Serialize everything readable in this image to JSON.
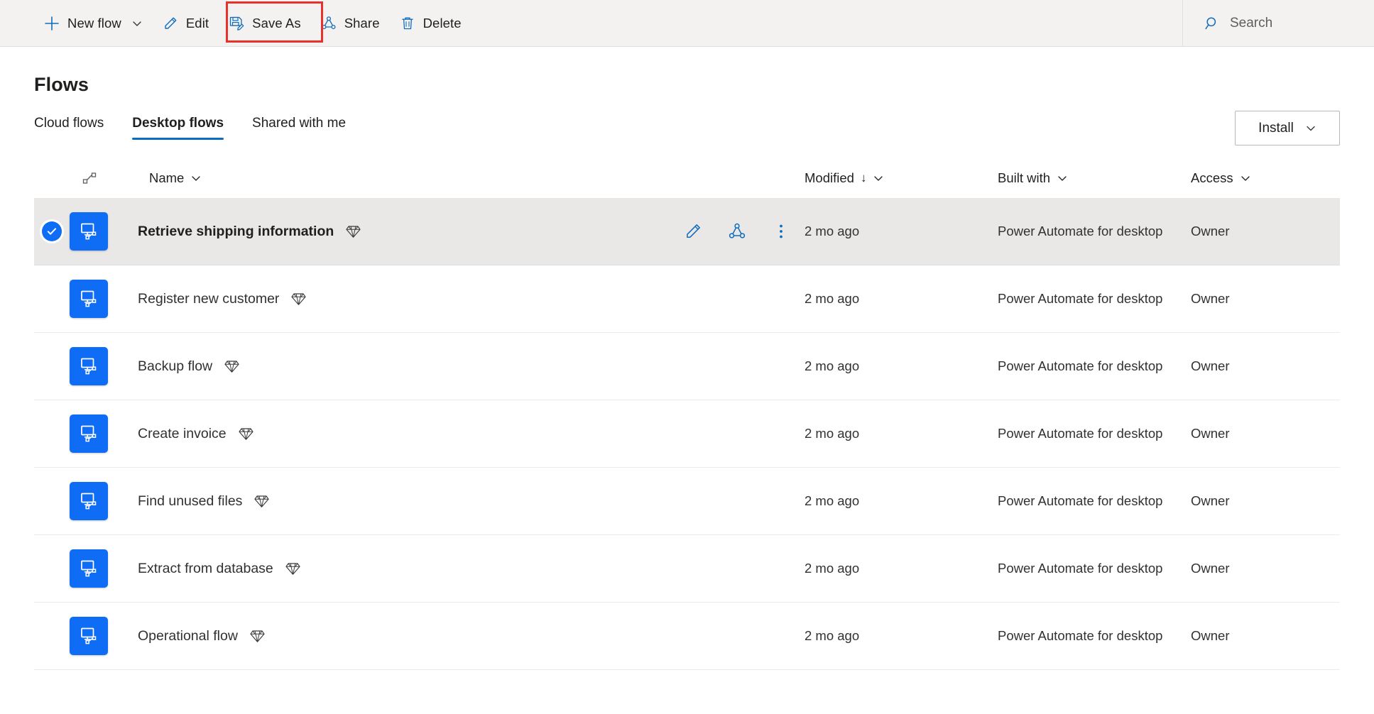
{
  "commandbar": {
    "buttons": [
      {
        "label": "New flow",
        "icon": "plus-icon",
        "has_chevron": true
      },
      {
        "label": "Edit",
        "icon": "pencil-icon",
        "has_chevron": false
      },
      {
        "label": "Save As",
        "icon": "save-as-icon",
        "has_chevron": false,
        "highlighted": true
      },
      {
        "label": "Share",
        "icon": "share-icon",
        "has_chevron": false
      },
      {
        "label": "Delete",
        "icon": "trash-icon",
        "has_chevron": false
      }
    ],
    "search": {
      "placeholder": "Search",
      "icon": "search-icon"
    },
    "highlight_color": "#e8312b"
  },
  "page": {
    "title": "Flows",
    "install": {
      "label": "Install",
      "icon": "chevron-down-icon"
    }
  },
  "tabs": [
    {
      "label": "Cloud flows",
      "active": false
    },
    {
      "label": "Desktop flows",
      "active": true
    },
    {
      "label": "Shared with me",
      "active": false
    }
  ],
  "table": {
    "columns": {
      "flow_icon": "flow-connector-icon",
      "name": "Name",
      "modified": "Modified",
      "modified_sort": "↓",
      "built_with": "Built with",
      "access": "Access"
    },
    "row_actions": [
      {
        "name": "edit-icon",
        "title": "Edit"
      },
      {
        "name": "share-icon",
        "title": "Share"
      },
      {
        "name": "more-options-icon",
        "title": "More commands"
      }
    ],
    "rows": [
      {
        "name": "Retrieve shipping information",
        "modified": "2 mo ago",
        "built_with": "Power Automate for desktop",
        "access": "Owner",
        "selected": true,
        "premium": true
      },
      {
        "name": "Register new customer",
        "modified": "2 mo ago",
        "built_with": "Power Automate for desktop",
        "access": "Owner",
        "selected": false,
        "premium": true
      },
      {
        "name": "Backup flow",
        "modified": "2 mo ago",
        "built_with": "Power Automate for desktop",
        "access": "Owner",
        "selected": false,
        "premium": true
      },
      {
        "name": "Create invoice",
        "modified": "2 mo ago",
        "built_with": "Power Automate for desktop",
        "access": "Owner",
        "selected": false,
        "premium": true
      },
      {
        "name": "Find unused files",
        "modified": "2 mo ago",
        "built_with": "Power Automate for desktop",
        "access": "Owner",
        "selected": false,
        "premium": true
      },
      {
        "name": "Extract from database",
        "modified": "2 mo ago",
        "built_with": "Power Automate for desktop",
        "access": "Owner",
        "selected": false,
        "premium": true
      },
      {
        "name": "Operational flow",
        "modified": "2 mo ago",
        "built_with": "Power Automate for desktop",
        "access": "Owner",
        "selected": false,
        "premium": true
      }
    ]
  },
  "colors": {
    "accent": "#0f6cbd",
    "tile_blue": "#0f6cf5",
    "commandbar_bg": "#f3f2f1",
    "selected_row": "#e9e8e7"
  }
}
